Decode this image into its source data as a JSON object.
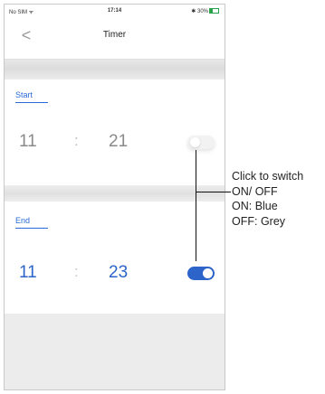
{
  "status_bar": {
    "carrier": "No SIM ᯤ",
    "time": "17:14",
    "battery": "✱ 30%"
  },
  "nav": {
    "back_icon": "chevron-left-icon",
    "back_glyph": "<",
    "title": "Timer"
  },
  "start": {
    "label": "Start",
    "hour": "11",
    "separator": ":",
    "minute": "21",
    "toggle_state": "off"
  },
  "end": {
    "label": "End",
    "hour": "11",
    "separator": ":",
    "minute": "23",
    "toggle_state": "on"
  },
  "annotation": {
    "line1": "Click to switch",
    "line2": "ON/ OFF",
    "line3": "ON: Blue",
    "line4": "OFF: Grey"
  },
  "colors": {
    "accent_blue": "#2c64c9",
    "off_grey": "#f2f2f2",
    "time_grey": "#8a8a8a"
  }
}
